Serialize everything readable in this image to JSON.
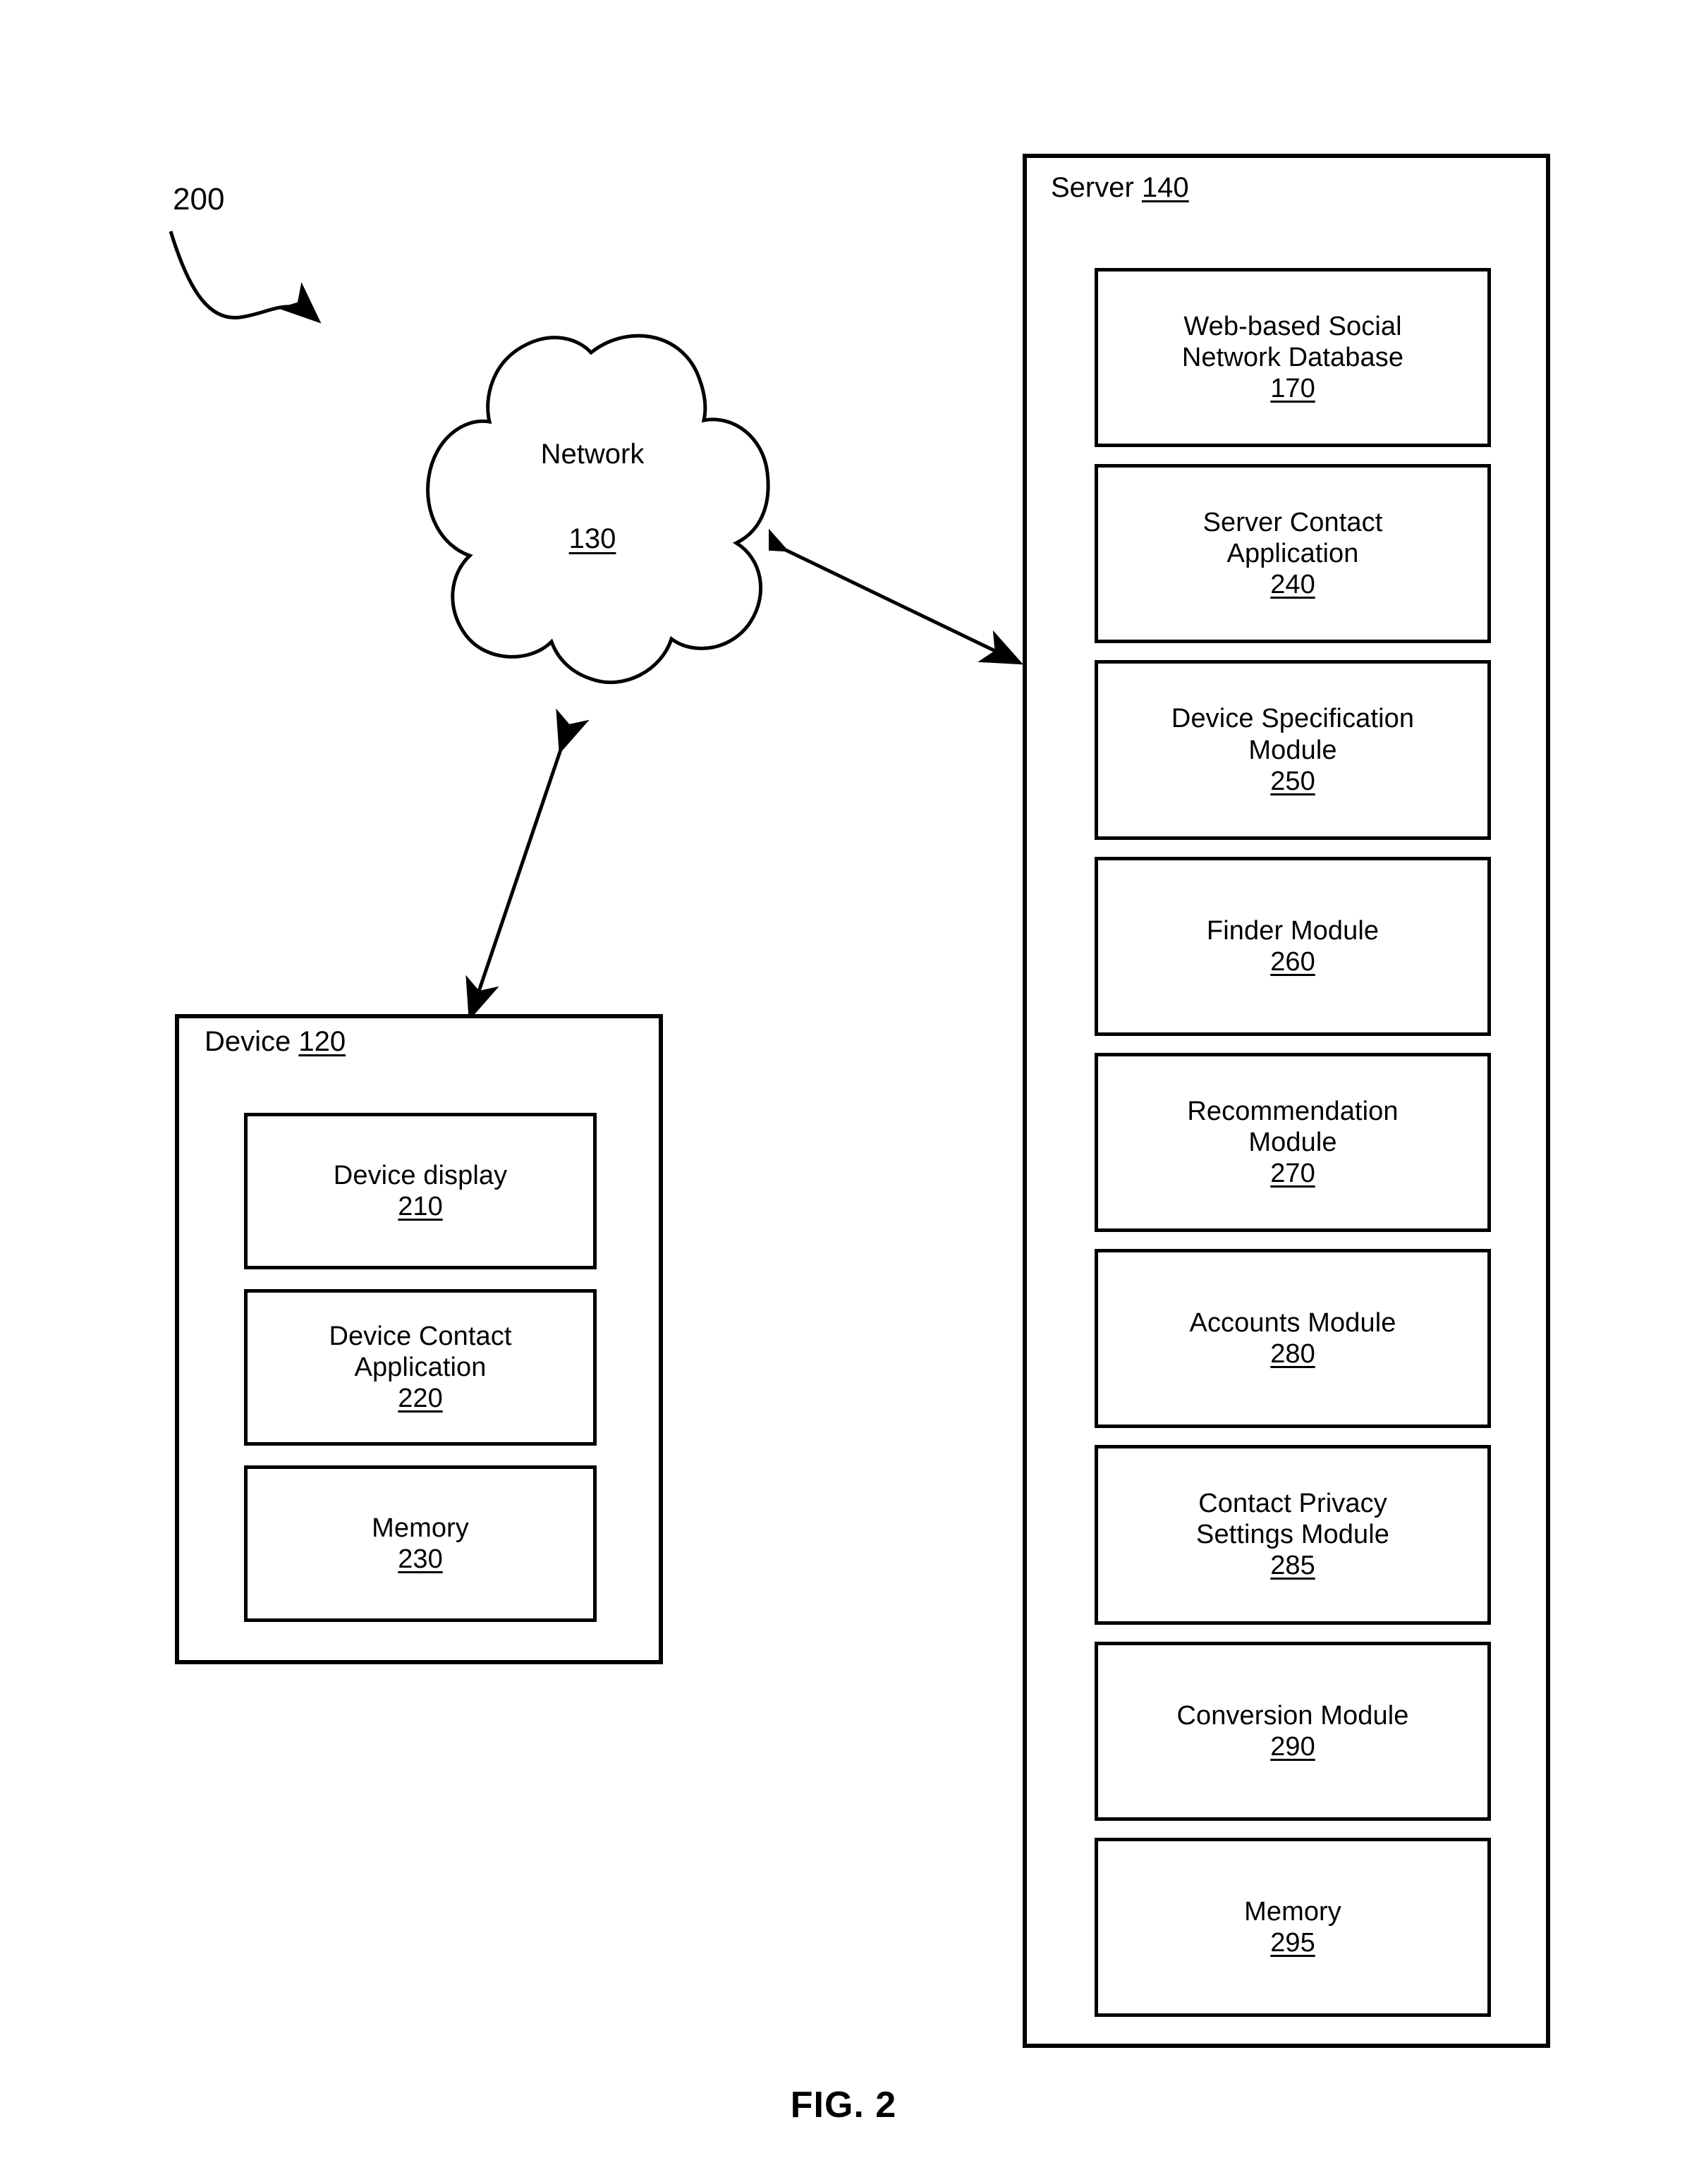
{
  "figure": {
    "caption": "FIG. 2",
    "diagram_ref": "200"
  },
  "network": {
    "label": "Network",
    "ref": "130",
    "shape": "cloud-icon"
  },
  "device": {
    "title_label": "Device",
    "title_ref": "120",
    "modules": [
      {
        "lines": [
          "Device display"
        ],
        "ref": "210"
      },
      {
        "lines": [
          "Device Contact",
          "Application"
        ],
        "ref": "220"
      },
      {
        "lines": [
          "Memory"
        ],
        "ref": "230"
      }
    ]
  },
  "server": {
    "title_label": "Server",
    "title_ref": "140",
    "modules": [
      {
        "lines": [
          "Web-based Social",
          "Network Database"
        ],
        "ref": "170"
      },
      {
        "lines": [
          "Server Contact",
          "Application"
        ],
        "ref": "240"
      },
      {
        "lines": [
          "Device Specification",
          "Module"
        ],
        "ref": "250"
      },
      {
        "lines": [
          "Finder Module"
        ],
        "ref": "260"
      },
      {
        "lines": [
          "Recommendation",
          "Module"
        ],
        "ref": "270"
      },
      {
        "lines": [
          "Accounts Module"
        ],
        "ref": "280"
      },
      {
        "lines": [
          "Contact Privacy",
          "Settings Module"
        ],
        "ref": "285"
      },
      {
        "lines": [
          "Conversion Module"
        ],
        "ref": "290"
      },
      {
        "lines": [
          "Memory"
        ],
        "ref": "295"
      }
    ]
  },
  "connectors": [
    {
      "name": "device-network-link",
      "from": "Device 120",
      "to": "Network 130",
      "style": "double-headed-arrow"
    },
    {
      "name": "network-server-link",
      "from": "Network 130",
      "to": "Server 140",
      "style": "double-headed-arrow"
    }
  ],
  "colors": {
    "stroke": "#000000",
    "background": "#ffffff"
  }
}
